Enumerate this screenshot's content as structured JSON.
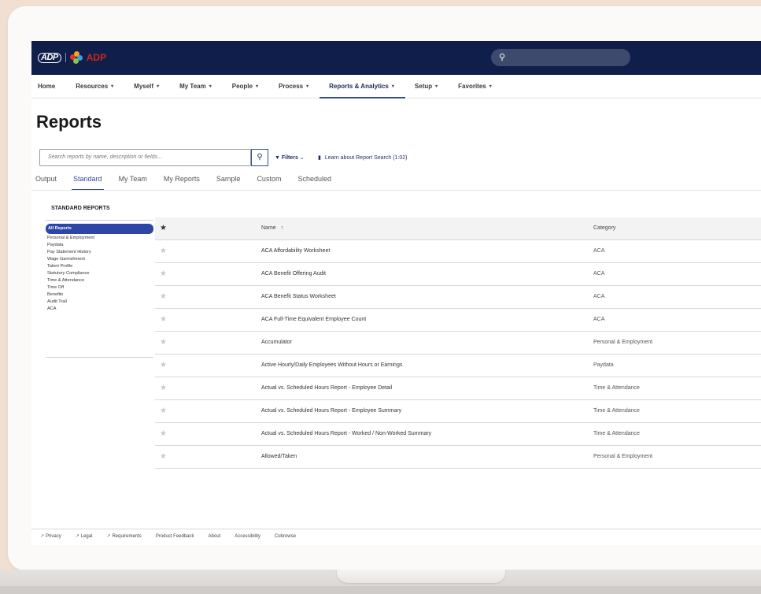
{
  "brand": {
    "logo_mark": "ADP",
    "product_name": "ADP"
  },
  "search": {
    "icon": "search-icon"
  },
  "nav": {
    "items": [
      {
        "label": "Home",
        "has_menu": false
      },
      {
        "label": "Resources",
        "has_menu": true
      },
      {
        "label": "Myself",
        "has_menu": true
      },
      {
        "label": "My Team",
        "has_menu": true
      },
      {
        "label": "People",
        "has_menu": true
      },
      {
        "label": "Process",
        "has_menu": true
      },
      {
        "label": "Reports & Analytics",
        "has_menu": true,
        "active": true
      },
      {
        "label": "Setup",
        "has_menu": true
      },
      {
        "label": "Favorites",
        "has_menu": true
      }
    ]
  },
  "page": {
    "title": "Reports"
  },
  "report_search": {
    "placeholder": "Search reports by name, description or fields...",
    "filters_label": "Filters",
    "learn_label": "Learn about Report Search (1:02)"
  },
  "tabs": [
    {
      "label": "Output"
    },
    {
      "label": "Standard",
      "active": true
    },
    {
      "label": "My Team"
    },
    {
      "label": "My Reports"
    },
    {
      "label": "Sample"
    },
    {
      "label": "Custom"
    },
    {
      "label": "Scheduled"
    }
  ],
  "sidebar": {
    "title": "STANDARD REPORTS",
    "items": [
      {
        "label": "All Reports",
        "active": true
      },
      {
        "label": "Personal & Employment"
      },
      {
        "label": "Paydata"
      },
      {
        "label": "Pay Statement History"
      },
      {
        "label": "Wage Garnishment"
      },
      {
        "label": "Talent Profile"
      },
      {
        "label": "Statutory Compliance"
      },
      {
        "label": "Time & Attendance"
      },
      {
        "label": "Time Off"
      },
      {
        "label": "Benefits"
      },
      {
        "label": "Audit Trail"
      },
      {
        "label": "ACA"
      }
    ]
  },
  "table": {
    "headers": {
      "name": "Name",
      "sort_indicator": "↑",
      "category": "Category"
    },
    "rows": [
      {
        "name": "ACA Affordability Worksheet",
        "category": "ACA"
      },
      {
        "name": "ACA Benefit Offering Audit",
        "category": "ACA"
      },
      {
        "name": "ACA Benefit Status Worksheet",
        "category": "ACA"
      },
      {
        "name": "ACA Full-Time Equivalent Employee Count",
        "category": "ACA"
      },
      {
        "name": "Accumulator",
        "category": "Personal & Employment"
      },
      {
        "name": "Active Hourly/Daily Employees Without Hours or Earnings",
        "category": "Paydata"
      },
      {
        "name": "Actual vs. Scheduled Hours Report - Employee Detail",
        "category": "Time & Attendance"
      },
      {
        "name": "Actual vs. Scheduled Hours Report - Employee Summary",
        "category": "Time & Attendance"
      },
      {
        "name": "Actual vs. Scheduled Hours Report - Worked / Non-Worked Summary",
        "category": "Time & Attendance"
      },
      {
        "name": "Allowed/Taken",
        "category": "Personal & Employment"
      }
    ]
  },
  "footer": {
    "links": [
      {
        "label": "Privacy",
        "external": true
      },
      {
        "label": "Legal",
        "external": true
      },
      {
        "label": "Requirements",
        "external": true
      },
      {
        "label": "Product Feedback",
        "external": false
      },
      {
        "label": "About",
        "external": false
      },
      {
        "label": "Accessibility",
        "external": false
      },
      {
        "label": "Cobrowse",
        "external": false
      }
    ]
  },
  "colors": {
    "topbar": "#0f1e4a",
    "accent": "#324a9e",
    "active_pill": "#2d46a8",
    "brand_red": "#d0271d"
  }
}
